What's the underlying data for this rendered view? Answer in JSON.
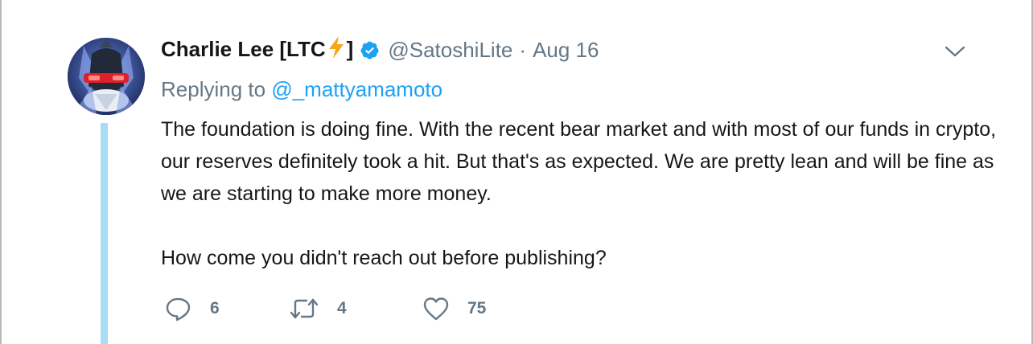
{
  "tweet": {
    "author_name": "Charlie Lee [LTC",
    "author_name_suffix": "]",
    "handle": "@SatoshiLite",
    "separator": "·",
    "date": "Aug 16",
    "replying_prefix": "Replying to",
    "replying_mention": "@_mattyamamoto",
    "body_paragraph_1": "The foundation is doing fine. With the recent bear market and with most of our funds in crypto, our reserves definitely took a hit. But that's as expected. We are pretty lean and will be fine as we are starting to make more money.",
    "body_paragraph_2": "How come you didn't reach out before publishing?"
  },
  "actions": {
    "reply_count": "6",
    "retweet_count": "4",
    "like_count": "75"
  },
  "icons": {
    "bolt": "lightning-bolt-icon",
    "verified": "verified-badge-icon",
    "caret": "chevron-down-icon",
    "reply": "reply-bubble-icon",
    "retweet": "retweet-icon",
    "like": "heart-icon"
  },
  "colors": {
    "text": "#14171a",
    "secondary": "#657786",
    "link": "#1da1f2",
    "thread_line": "#a9dcf6",
    "bolt": "#f7a51a"
  }
}
